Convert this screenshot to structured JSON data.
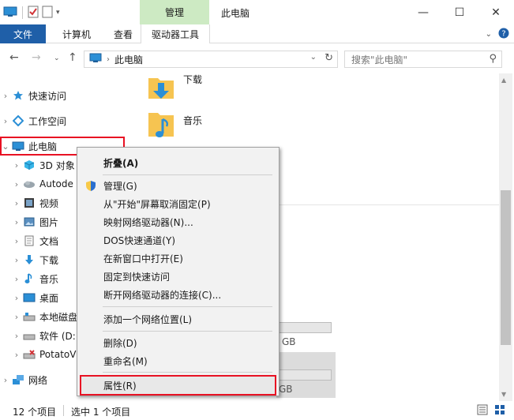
{
  "window": {
    "title": "此电脑",
    "contextual_tab": "管理",
    "controls": [
      "—",
      "☐",
      "✕"
    ]
  },
  "ribbon": {
    "file": "文件",
    "tabs": [
      "计算机",
      "查看",
      "驱动器工具"
    ]
  },
  "address": {
    "path": "此电脑",
    "search_placeholder": "搜索\"此电脑\""
  },
  "nav": {
    "items": [
      {
        "label": "快速访问",
        "icon": "star-icon"
      },
      {
        "label": "工作空间",
        "icon": "workspace-icon"
      },
      {
        "label": "此电脑",
        "icon": "pc-icon"
      },
      {
        "label": "3D 对象",
        "icon": "cube-icon"
      },
      {
        "label": "Autode",
        "icon": "cloud-icon"
      },
      {
        "label": "视频",
        "icon": "video-icon"
      },
      {
        "label": "图片",
        "icon": "picture-icon"
      },
      {
        "label": "文档",
        "icon": "document-icon"
      },
      {
        "label": "下载",
        "icon": "download-icon"
      },
      {
        "label": "音乐",
        "icon": "music-icon"
      },
      {
        "label": "桌面",
        "icon": "desktop-icon"
      },
      {
        "label": "本地磁盘",
        "icon": "disk-icon"
      },
      {
        "label": "软件 (D:",
        "icon": "disk-icon"
      },
      {
        "label": "PotatoV",
        "icon": "drive-x-icon"
      },
      {
        "label": "网络",
        "icon": "network-icon"
      }
    ]
  },
  "content": {
    "folders": [
      {
        "label": "下载",
        "icon": "download-folder-icon"
      },
      {
        "label": "音乐",
        "icon": "music-folder-icon"
      }
    ],
    "drive_sizes": [
      "GB",
      "GB"
    ]
  },
  "context_menu": {
    "items": [
      {
        "label": "折叠(A)",
        "bold": true
      },
      {
        "label": "管理(G)"
      },
      {
        "label": "从\"开始\"屏幕取消固定(P)"
      },
      {
        "label": "映射网络驱动器(N)..."
      },
      {
        "label": "DOS快速通道(Y)"
      },
      {
        "label": "在新窗口中打开(E)"
      },
      {
        "label": "固定到快速访问"
      },
      {
        "label": "断开网络驱动器的连接(C)..."
      },
      {
        "label": "添加一个网络位置(L)"
      },
      {
        "label": "删除(D)"
      },
      {
        "label": "重命名(M)"
      },
      {
        "label": "属性(R)"
      }
    ]
  },
  "status": {
    "count": "12 个项目",
    "selected": "选中 1 个项目"
  },
  "colors": {
    "accent": "#1f5fa8",
    "contextual_tab": "#cdeac3",
    "highlight_box": "#e81123"
  }
}
